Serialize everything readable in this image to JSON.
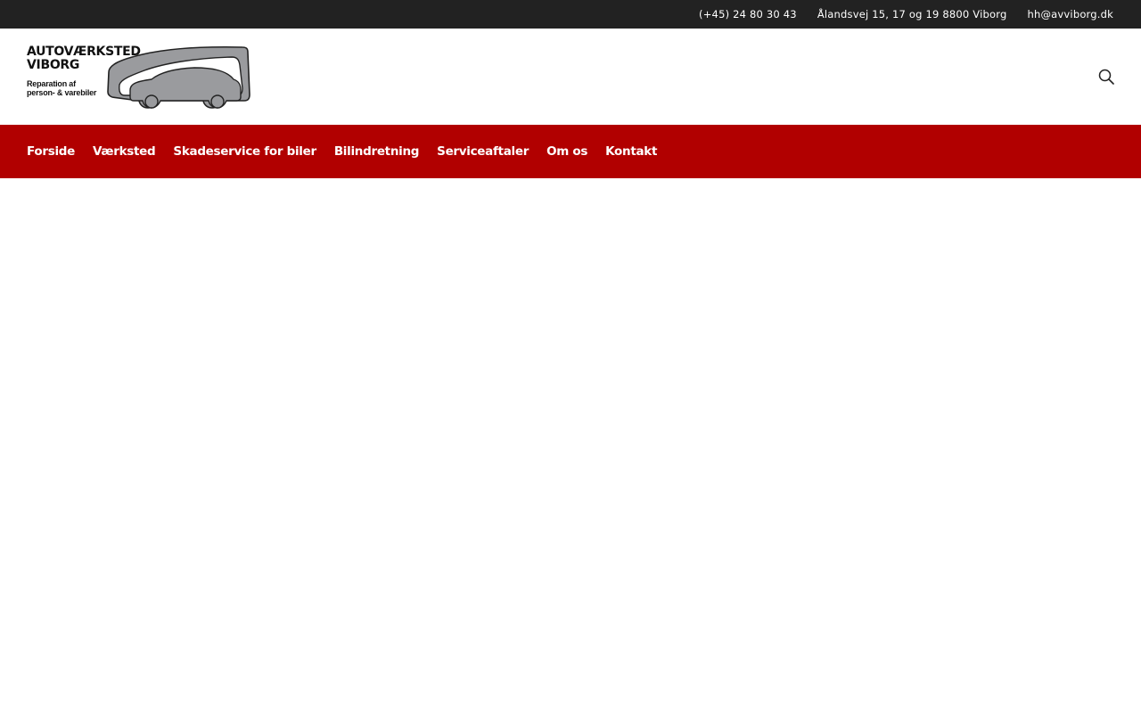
{
  "topbar": {
    "phone": "(+45) 24 80 30 43",
    "address": "Ålandsvej 15, 17 og 19 8800 Viborg",
    "email": "hh@avviborg.dk"
  },
  "logo": {
    "line1": "AUTOVÆRKSTED",
    "line2": "VIBORG",
    "sub1": "Reparation af",
    "sub2": "person- & varebiler"
  },
  "header": {
    "search_icon": "search-icon"
  },
  "nav": {
    "items": [
      {
        "label": "Forside"
      },
      {
        "label": "Værksted"
      },
      {
        "label": "Skadeservice for biler"
      },
      {
        "label": "Bilindretning"
      },
      {
        "label": "Serviceaftaler"
      },
      {
        "label": "Om os"
      },
      {
        "label": "Kontakt"
      }
    ]
  },
  "colors": {
    "topbar_bg": "#222222",
    "nav_bg": "#b10000",
    "logo_car_fill": "#9a9b9e"
  }
}
